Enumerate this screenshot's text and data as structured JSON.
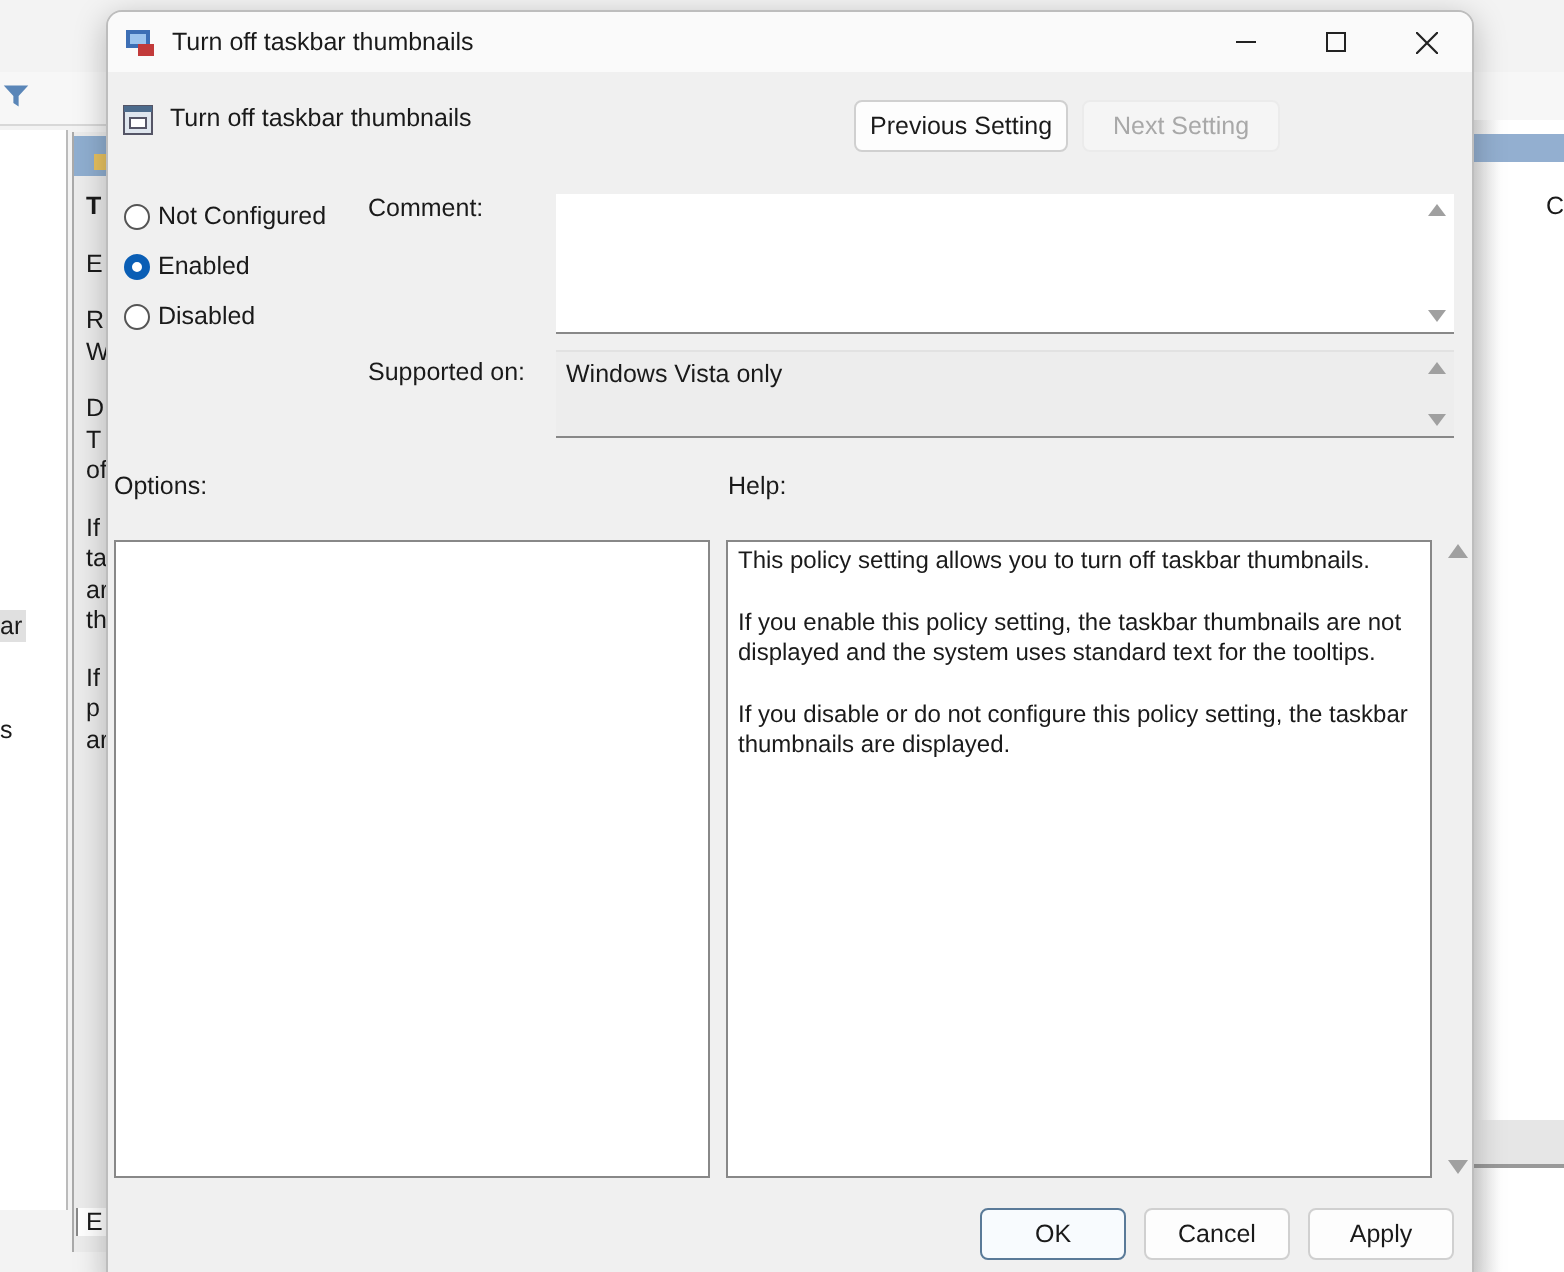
{
  "background_window": {
    "left_pane": {
      "items": [
        {
          "label": "ar",
          "selected": true
        },
        {
          "label": "s",
          "selected": false
        }
      ]
    },
    "description": {
      "title": "T",
      "paragraphs": [
        [
          "E"
        ],
        [
          "R",
          "W"
        ],
        [
          "D",
          "T",
          "of"
        ],
        [
          "If",
          "ta",
          "ar",
          "th"
        ],
        [
          "If",
          "p",
          "ar"
        ]
      ]
    },
    "tab": "E",
    "right_pane": {
      "column_1": "C"
    }
  },
  "dialog": {
    "title": "Turn off taskbar thumbnails",
    "setting_name": "Turn off taskbar thumbnails",
    "nav_buttons": [
      {
        "label": "Previous Setting",
        "disabled": false
      },
      {
        "label": "Next Setting",
        "disabled": true
      }
    ],
    "states": [
      {
        "label": "Not Configured",
        "selected": false
      },
      {
        "label": "Enabled",
        "selected": true
      },
      {
        "label": "Disabled",
        "selected": false
      }
    ],
    "comment_label": "Comment:",
    "supported_label": "Supported on:",
    "supported_value": "Windows Vista only",
    "options_label": "Options:",
    "help_label": "Help:",
    "help_paragraphs": [
      "This policy setting allows you to turn off taskbar thumbnails.",
      "If you enable this policy setting, the taskbar thumbnails are not displayed and the system uses standard text for the tooltips.",
      "If you disable or do not configure this policy setting, the taskbar thumbnails are displayed."
    ],
    "footer_buttons": [
      {
        "label": "OK",
        "default": true
      },
      {
        "label": "Cancel",
        "default": false
      },
      {
        "label": "Apply",
        "default": false
      }
    ]
  }
}
